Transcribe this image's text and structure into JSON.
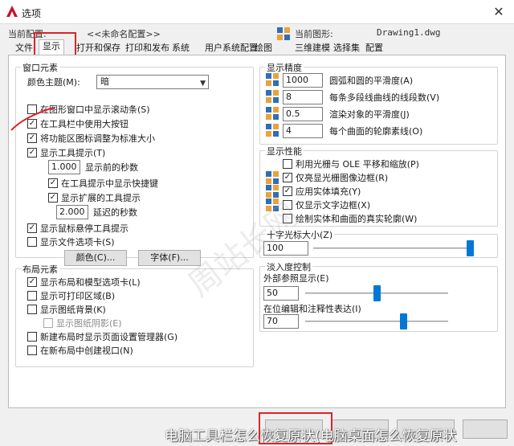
{
  "window": {
    "title": "选项",
    "close_symbol": "✕"
  },
  "profile": {
    "current_profile_label": "当前配置:",
    "current_profile_value": "<<未命名配置>>",
    "current_drawing_label": "当前图形:",
    "current_drawing_value": "Drawing1.dwg"
  },
  "tabs": [
    "文件",
    "显示",
    "打开和保存",
    "打印和发布",
    "系统",
    "用户系统配置",
    "绘图",
    "三维建模",
    "选择集",
    "配置"
  ],
  "window_elements": {
    "title": "窗口元素",
    "color_theme_label": "颜色主题(M):",
    "color_theme_value": "暗",
    "cb_scrollbars": "在图形窗口中显示滚动条(S)",
    "cb_large_buttons": "在工具栏中使用大按钮",
    "cb_ribbon_resize": "将功能区图标调整为标准大小",
    "cb_tooltips": "显示工具提示(T)",
    "tooltip_delay_value": "1.000",
    "tooltip_delay_label": "显示前的秒数",
    "cb_shortcut_keys": "在工具提示中显示快捷键",
    "cb_extended_tips": "显示扩展的工具提示",
    "extended_delay_value": "2.000",
    "extended_delay_label": "延迟的秒数",
    "cb_rollover": "显示鼠标悬停工具提示",
    "cb_file_tabs": "显示文件选项卡(S)",
    "colors_button": "颜色(C)...",
    "fonts_button": "字体(F)..."
  },
  "layout_elements": {
    "title": "布局元素",
    "cb_layout_tabs": "显示布局和模型选项卡(L)",
    "cb_printable_area": "显示可打印区域(B)",
    "cb_paper_background": "显示图纸背景(K)",
    "cb_paper_shadow": "显示图纸阴影(E)",
    "cb_page_setup": "新建布局时显示页面设置管理器(G)",
    "cb_create_viewport": "在新布局中创建视口(N)"
  },
  "display_resolution": {
    "title": "显示精度",
    "arc_value": "1000",
    "arc_label": "圆弧和圆的平滑度(A)",
    "pline_value": "8",
    "pline_label": "每条多段线曲线的线段数(V)",
    "render_value": "0.5",
    "render_label": "渲染对象的平滑度(J)",
    "contour_value": "4",
    "contour_label": "每个曲面的轮廓素线(O)"
  },
  "display_performance": {
    "title": "显示性能",
    "cb_pan_zoom": "利用光栅与 OLE 平移和缩放(P)",
    "cb_raster_frame": "仅亮显光栅图像边框(R)",
    "cb_solid_fill": "应用实体填充(Y)",
    "cb_text_frame": "仅显示文字边框(X)",
    "cb_silhouettes": "绘制实体和曲面的真实轮廓(W)"
  },
  "crosshair": {
    "title": "十字光标大小(Z)",
    "value": "100",
    "level_fraction": 1.0
  },
  "fade_control": {
    "title": "淡入度控制",
    "xref_label": "外部参照显示(E)",
    "xref_value": "50",
    "xref_fraction": 0.5,
    "inplace_label": "在位编辑和注释性表达(I)",
    "inplace_value": "70",
    "inplace_fraction": 0.7
  },
  "footer": {
    "caption": "电脑工具栏怎么恢复原状(电脑桌面怎么恢复原状",
    "watermark": "周站长网"
  },
  "colors": {
    "accent": "#0078d7",
    "highlight_box": "#d9252a"
  }
}
